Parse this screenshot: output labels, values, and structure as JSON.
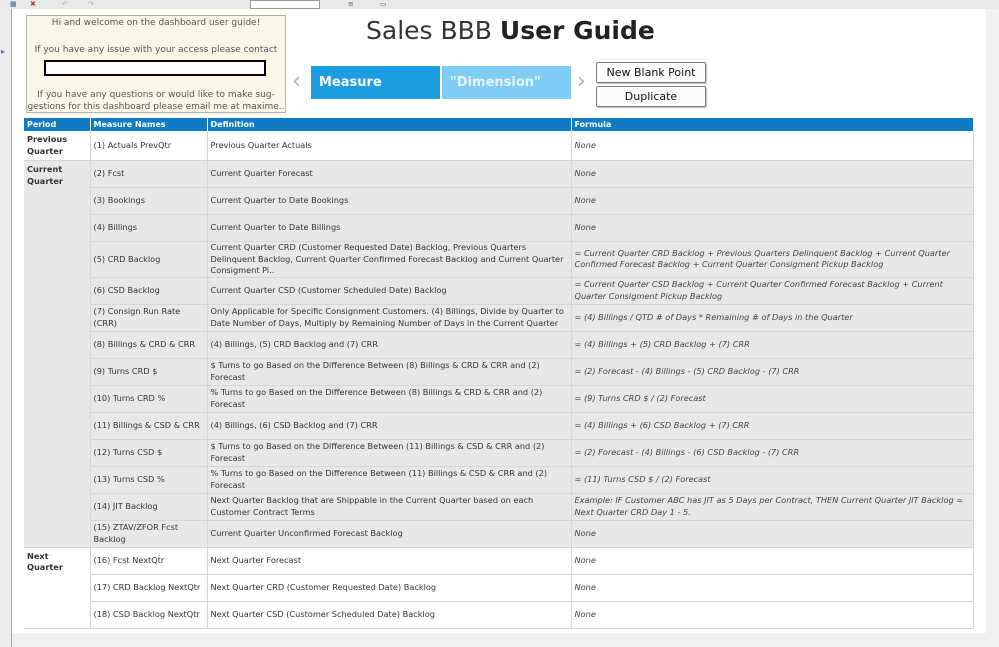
{
  "welcome": {
    "line1": "Hi and welcome on the dashboard user guide!",
    "line2": "If you have any issue with your access please contact",
    "line3": "If you have any questions or would like to make sug-",
    "line4": "gestions for this dashboard please email me at maxime.."
  },
  "title": {
    "prefix": "Sales BBB",
    "bold": "User Guide"
  },
  "nav": {
    "prev": "‹",
    "next": "›"
  },
  "tabs": {
    "measure": "Measure",
    "dimension": "\"Dimension\""
  },
  "buttons": {
    "new_blank_point": "New Blank Point",
    "duplicate": "Duplicate"
  },
  "table": {
    "headers": [
      "Period",
      "Measure Names",
      "Definition",
      "Formula"
    ],
    "groups": [
      {
        "label_line1": "Previous",
        "label_line2": "Quarter",
        "rows": [
          {
            "measure": "(1) Actuals PrevQtr",
            "definition": "Previous Quarter Actuals",
            "formula": "None"
          }
        ]
      },
      {
        "label_line1": "Current",
        "label_line2": "Quarter",
        "rows": [
          {
            "measure": "(2) Fcst",
            "definition": "Current Quarter Forecast",
            "formula": "None"
          },
          {
            "measure": "(3) Bookings",
            "definition": "Current Quarter to Date Bookings",
            "formula": "None"
          },
          {
            "measure": "(4) Billings",
            "definition": "Current Quarter to Date Billings",
            "formula": "None"
          },
          {
            "measure": "(5) CRD Backlog",
            "definition": "Current Quarter CRD (Customer Requested Date) Backlog, Previous Quarters Delinquent Backlog, Current Quarter Confirmed Forecast Backlog and Current Quarter Consigment Pi..",
            "formula": "= Current Quarter CRD Backlog + Previous Quarters Delinquent Backlog + Current Quarter Confirmed Forecast Backlog + Current Quarter Consigment Pickup Backlog"
          },
          {
            "measure": "(6) CSD Backlog",
            "definition": "Current Quarter CSD (Customer Scheduled Date) Backlog",
            "formula": "= Current Quarter CSD Backlog + Current Quarter Confirmed Forecast Backlog + Current Quarter Consigment Pickup Backlog"
          },
          {
            "measure": "(7) Consign Run Rate (CRR)",
            "definition": "Only Applicable for Specific Consignment Customers. (4) Billings, Divide by Quarter to Date Number of Days, Multiply by Remaining Number of Days in the Current Quarter",
            "formula": "= (4) Billings / QTD # of Days * Remaining # of Days in the Quarter"
          },
          {
            "measure": "(8) Billings & CRD & CRR",
            "definition": "(4) Billings, (5) CRD Backlog and (7) CRR",
            "formula": "= (4) Billings + (5) CRD Backlog + (7) CRR"
          },
          {
            "measure": "(9) Turns CRD $",
            "definition": "$ Turns to go Based on the Difference Between (8) Billings & CRD & CRR and (2) Forecast",
            "formula": "= (2) Forecast - (4) Billings - (5) CRD Backlog - (7) CRR"
          },
          {
            "measure": "(10) Turns CRD %",
            "definition": "% Turns to go Based on the Difference Between (8) Billings & CRD & CRR and (2) Forecast",
            "formula": "=  (9) Turns CRD $ / (2) Forecast"
          },
          {
            "measure": "(11) Billings & CSD & CRR",
            "definition": "(4) Billings, (6) CSD Backlog and (7) CRR",
            "formula": "= (4) Billings + (6) CSD Backlog + (7) CRR"
          },
          {
            "measure": "(12) Turns CSD $",
            "definition": "$ Turns to go Based on the Difference Between (11) Billings & CSD & CRR and (2) Forecast",
            "formula": "= (2) Forecast - (4) Billings - (6) CSD Backlog - (7) CRR"
          },
          {
            "measure": "(13) Turns CSD %",
            "definition": "% Turns to go Based on the Difference Between (11) Billings & CSD & CRR and (2) Forecast",
            "formula": "=  (11) Turns CSD $ / (2) Forecast"
          },
          {
            "measure": "(14) JIT Backlog",
            "definition": "Next Quarter Backlog that are Shippable in the Current Quarter based on each Customer Contract Terms",
            "formula": "Example: IF Customer ABC has JIT as 5 Days per Contract, THEN Current Quarter JIT Backlog  =  Next Quarter CRD Day 1 - 5."
          },
          {
            "measure": "(15) ZTAV/ZFOR Fcst Backlog",
            "definition": "Current Quarter Unconfirmed Forecast Backlog",
            "formula": "None"
          }
        ]
      },
      {
        "label_line1": "Next Quarter",
        "label_line2": "",
        "rows": [
          {
            "measure": "(16) Fcst NextQtr",
            "definition": "Next Quarter Forecast",
            "formula": "None"
          },
          {
            "measure": "(17) CRD Backlog NextQtr",
            "definition": "Next Quarter CRD (Customer Requested Date) Backlog",
            "formula": "None"
          },
          {
            "measure": "(18) CSD Backlog NextQtr",
            "definition": "Next Quarter CSD (Customer Scheduled Date) Backlog",
            "formula": "None"
          }
        ]
      }
    ]
  }
}
